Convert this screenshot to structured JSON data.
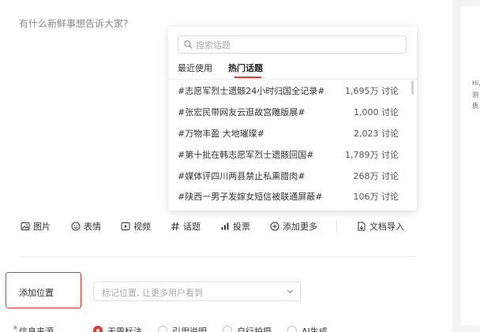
{
  "composer": {
    "placeholder": "有什么新鲜事想告诉大家?"
  },
  "right_panel": {
    "lines": [
      "Hi,",
      "测",
      "质"
    ]
  },
  "toolbar": {
    "items": [
      {
        "label": "图片",
        "icon": "image-icon"
      },
      {
        "label": "表情",
        "icon": "emoji-icon"
      },
      {
        "label": "视频",
        "icon": "video-icon"
      },
      {
        "label": "话题",
        "icon": "hashtag-icon"
      },
      {
        "label": "投票",
        "icon": "poll-icon"
      },
      {
        "label": "添加更多",
        "icon": "plus-circle-icon"
      },
      {
        "label": "文档导入",
        "icon": "document-import-icon"
      }
    ]
  },
  "topic_popup": {
    "search_placeholder": "搜索话题",
    "tabs": [
      {
        "label": "最近使用",
        "active": false
      },
      {
        "label": "热门话题",
        "active": true
      }
    ],
    "topics": [
      {
        "name": "#志愿军烈士遗骸24小时归国全记录#",
        "count": "1,695万 讨论"
      },
      {
        "name": "#张宏民带网友云逛故宫雕版展#",
        "count": "1,000 讨论"
      },
      {
        "name": "#万物丰盈 大地璀璨#",
        "count": "2,023 讨论"
      },
      {
        "name": "#第十批在韩志愿军烈士遗骸回国#",
        "count": "1,789万 讨论"
      },
      {
        "name": "#媒体评四川两县禁止私熏腊肉#",
        "count": "268万 讨论"
      },
      {
        "name": "#陕西一男子发嫁女短信被联通屏蔽#",
        "count": "106万 讨论"
      }
    ]
  },
  "location": {
    "label": "添加位置",
    "select_placeholder": "标记位置, 让更多用户看到"
  },
  "source": {
    "required_mark": "*",
    "label": "信息来源",
    "options": [
      {
        "label": "无需标注",
        "checked": true
      },
      {
        "label": "引用说明",
        "checked": false
      },
      {
        "label": "自行拍摄",
        "checked": false
      },
      {
        "label": "AI生成",
        "checked": false
      }
    ]
  },
  "colors": {
    "accent": "#e23b2e"
  }
}
